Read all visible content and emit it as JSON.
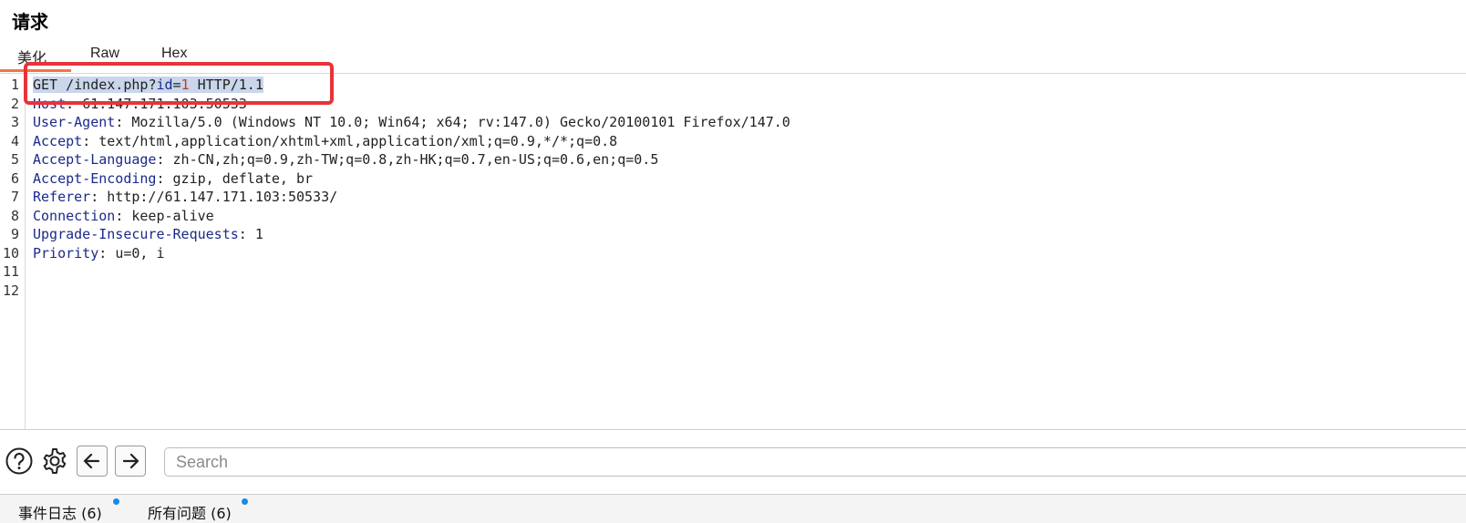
{
  "panel": {
    "title": "请求"
  },
  "tabs": [
    {
      "label": "美化",
      "active": true
    },
    {
      "label": "Raw",
      "active": false
    },
    {
      "label": "Hex",
      "active": false
    }
  ],
  "request": {
    "line_numbers": [
      "1",
      "2",
      "3",
      "4",
      "5",
      "6",
      "7",
      "8",
      "9",
      "10",
      "11",
      "12"
    ],
    "request_line": {
      "method_path": "GET /index.php",
      "query_sep": "?",
      "param_name": "id",
      "equals": "=",
      "param_value": "1",
      "protocol": " HTTP/1.1"
    },
    "headers": [
      {
        "name": "Host",
        "value": "61.147.171.103:50533"
      },
      {
        "name": "User-Agent",
        "value": "Mozilla/5.0 (Windows NT 10.0; Win64; x64; rv:147.0) Gecko/20100101 Firefox/147.0"
      },
      {
        "name": "Accept",
        "value": "text/html,application/xhtml+xml,application/xml;q=0.9,*/*;q=0.8"
      },
      {
        "name": "Accept-Language",
        "value": "zh-CN,zh;q=0.9,zh-TW;q=0.8,zh-HK;q=0.7,en-US;q=0.6,en;q=0.5"
      },
      {
        "name": "Accept-Encoding",
        "value": "gzip, deflate, br"
      },
      {
        "name": "Referer",
        "value": "http://61.147.171.103:50533/"
      },
      {
        "name": "Connection",
        "value": "keep-alive"
      },
      {
        "name": "Upgrade-Insecure-Requests",
        "value": "1"
      },
      {
        "name": "Priority",
        "value": "u=0, i"
      }
    ],
    "separator": ": "
  },
  "toolbar": {
    "search_placeholder": "Search",
    "icons": [
      "help-icon",
      "gear-icon",
      "arrow-left-icon",
      "arrow-right-icon"
    ]
  },
  "status": {
    "event_log": "事件日志 (6)",
    "all_issues": "所有问题 (6)"
  },
  "colors": {
    "accent": "#ee7744",
    "annotation": "#e8333a",
    "header_name": "#1a2a8a",
    "param_value": "#c0392b",
    "selection": "#c9d6ec",
    "notification": "#1a8ae8"
  }
}
